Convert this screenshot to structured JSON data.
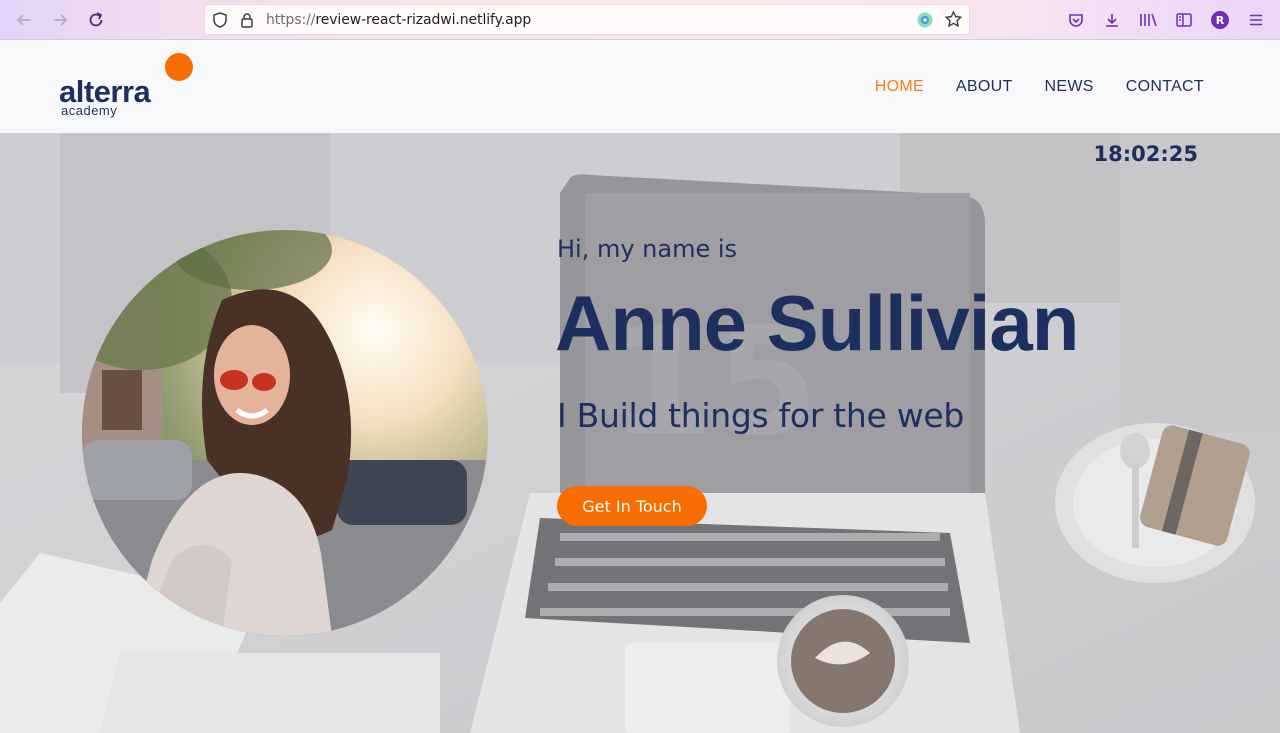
{
  "browser": {
    "url_scheme": "https://",
    "url_host": "review-react-rizadwi.netlify.app",
    "profile_initial": "R",
    "icons": [
      "back-arrow-icon",
      "forward-arrow-icon",
      "reload-icon",
      "shield-icon",
      "lock-icon",
      "extension-icon",
      "star-icon",
      "pocket-icon",
      "download-icon",
      "library-icon",
      "sidebar-icon",
      "profile-icon",
      "hamburger-menu-icon"
    ]
  },
  "header": {
    "logo_word": "alterra",
    "logo_sub": "academy",
    "nav": [
      {
        "label": "HOME"
      },
      {
        "label": "ABOUT"
      },
      {
        "label": "NEWS"
      },
      {
        "label": "CONTACT"
      }
    ]
  },
  "hero": {
    "clock": "18:02:25",
    "greeting": "Hi, my name is",
    "name": "Anne Sullivian",
    "tagline": "I Build things for the web",
    "cta_label": "Get In Touch"
  },
  "colors": {
    "brand_navy": "#1c2f5f",
    "accent_orange": "#f96d00",
    "active_nav": "#f57f17"
  }
}
